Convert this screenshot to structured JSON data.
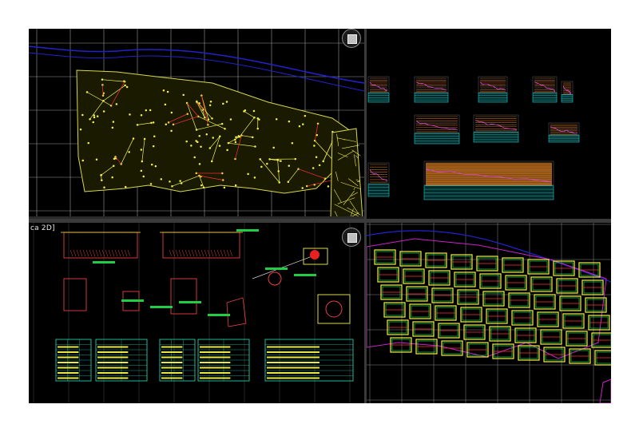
{
  "viewports": {
    "top_left": {
      "name": "plan-view-network"
    },
    "top_right": {
      "name": "profile-sheets"
    },
    "bottom_left": {
      "name": "details-view",
      "label": "ca 2D]"
    },
    "bottom_right": {
      "name": "network-detail-view"
    }
  },
  "icons": {
    "nav_cube": "view-cube-icon"
  },
  "colors": {
    "background": "#000000",
    "grid": "#9a9a9a",
    "contours": "#d8d84a",
    "network": "#f0f050",
    "pipes": "#ff3030",
    "river": "#2222cc",
    "profile_labels": "#22d0d0",
    "detail_borders": "#22ccaa",
    "parcels": "#cc22cc",
    "detail_drawings": "#e84040"
  }
}
